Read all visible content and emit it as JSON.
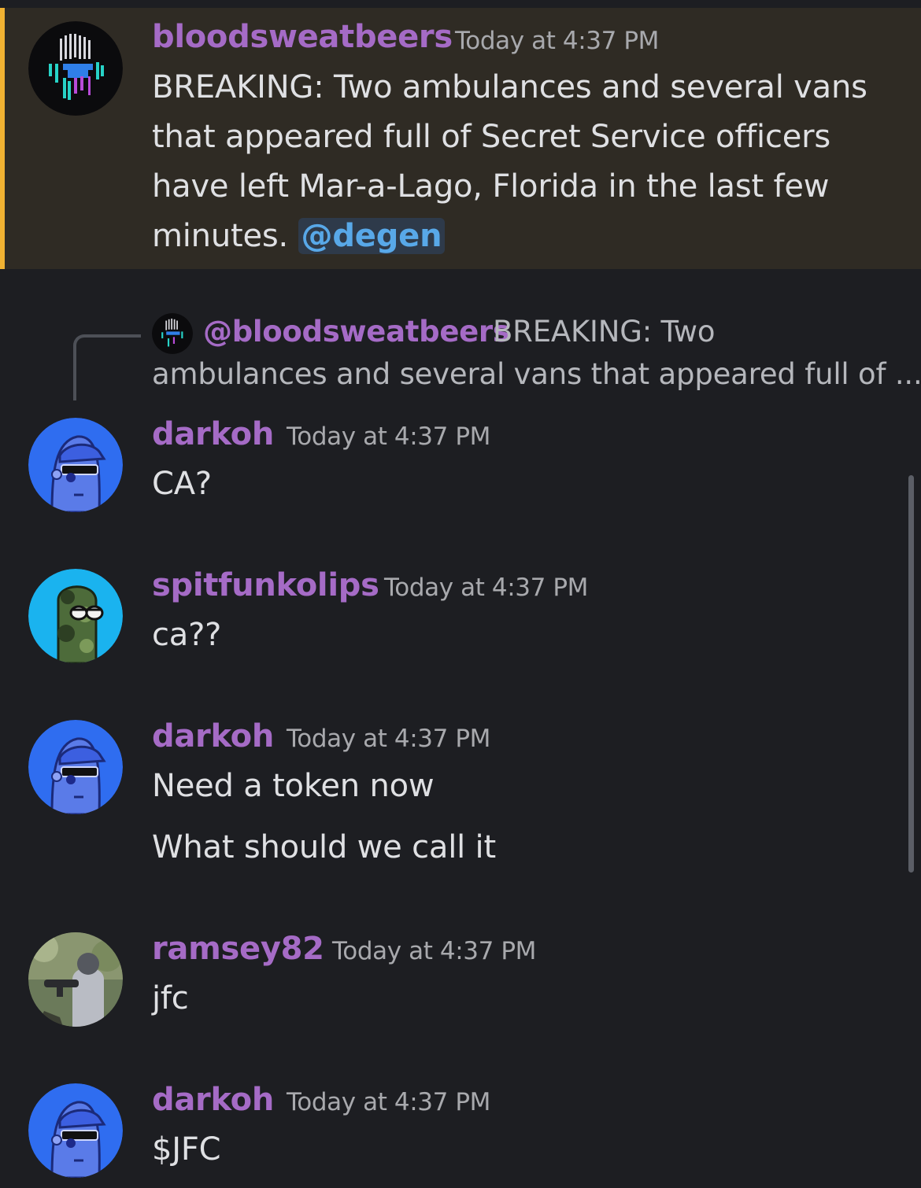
{
  "messages": [
    {
      "author": "bloodsweatbeers",
      "time": "Today at 4:37 PM",
      "lines": [
        "BREAKING: Two ambulances and several vans",
        "that appeared full of Secret Service officers",
        "have left Mar-a-Lago, Florida in the last few",
        "minutes."
      ],
      "mention": "@degen",
      "highlighted": true,
      "accent_color": "#f0b232"
    },
    {
      "reply_to": {
        "author": "@bloodsweatbeers",
        "line1": "BREAKING: Two",
        "line2": "ambulances and several vans that appeared full of ..."
      },
      "author": "darkoh",
      "time": "Today at 4:37 PM",
      "lines": [
        "CA?"
      ]
    },
    {
      "author": "spitfunkolips",
      "time": "Today at 4:37 PM",
      "lines": [
        "ca??"
      ]
    },
    {
      "author": "darkoh",
      "time": "Today at 4:37 PM",
      "lines": [
        "Need a token now",
        "What should we call it"
      ]
    },
    {
      "author": "ramsey82",
      "time": "Today at 4:37 PM",
      "lines": [
        "jfc"
      ]
    },
    {
      "author": "darkoh",
      "time": "Today at 4:37 PM",
      "lines": [
        "$JFC"
      ]
    }
  ],
  "colors": {
    "background": "#1d1e22",
    "highlight_background": "#2f2b24",
    "username": "#a56bc6",
    "timestamp": "#a8a9ad",
    "mention_text": "#58a8e8"
  }
}
